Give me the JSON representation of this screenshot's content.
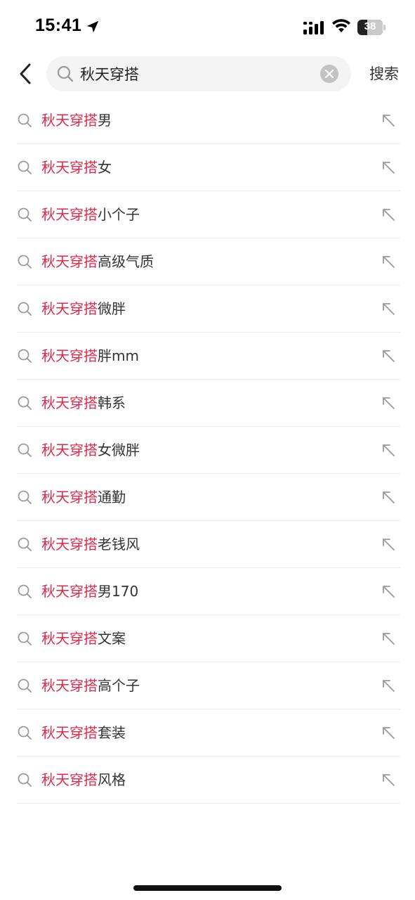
{
  "status_bar": {
    "time": "15:41",
    "battery": "38",
    "battery_level": 0.38,
    "location_icon": "location-arrow-icon",
    "signal_icon": "cellular-signal-icon",
    "wifi_icon": "wifi-icon",
    "battery_icon": "battery-icon"
  },
  "header": {
    "back_icon": "chevron-left-icon",
    "search_icon": "search-icon",
    "search_value": "秋天穿搭",
    "clear_icon": "clear-circle-icon",
    "search_button_label": "搜索"
  },
  "colors": {
    "highlight": "#e0294a",
    "text": "#333333",
    "icon_gray": "#9a9a9a",
    "search_bg": "#f3f3f3"
  },
  "suggestions": [
    {
      "highlight": "秋天穿搭",
      "rest": "男"
    },
    {
      "highlight": "秋天穿搭",
      "rest": "女"
    },
    {
      "highlight": "秋天穿搭",
      "rest": "小个子"
    },
    {
      "highlight": "秋天穿搭",
      "rest": "高级气质"
    },
    {
      "highlight": "秋天穿搭",
      "rest": "微胖"
    },
    {
      "highlight": "秋天穿搭",
      "rest": "胖mm"
    },
    {
      "highlight": "秋天穿搭",
      "rest": "韩系"
    },
    {
      "highlight": "秋天穿搭",
      "rest": "女微胖"
    },
    {
      "highlight": "秋天穿搭",
      "rest": "通勤"
    },
    {
      "highlight": "秋天穿搭",
      "rest": "老钱风"
    },
    {
      "highlight": "秋天穿搭",
      "rest": "男170"
    },
    {
      "highlight": "秋天穿搭",
      "rest": "文案"
    },
    {
      "highlight": "秋天穿搭",
      "rest": "高个子"
    },
    {
      "highlight": "秋天穿搭",
      "rest": "套装"
    },
    {
      "highlight": "秋天穿搭",
      "rest": "风格"
    }
  ],
  "suggestion_icons": {
    "left": "search-icon",
    "right": "fill-query-arrow-icon"
  }
}
